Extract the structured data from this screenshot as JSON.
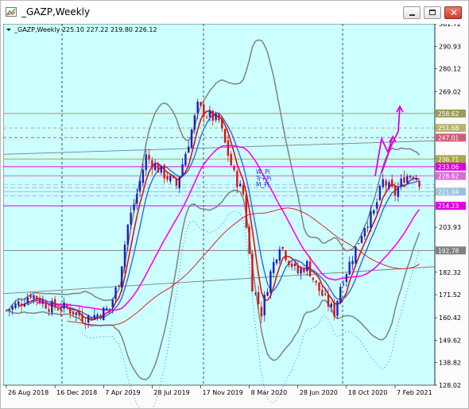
{
  "window": {
    "title": "_GAZP,Weekly",
    "buttons": [
      "minimize",
      "maximize",
      "close"
    ]
  },
  "chart_data": {
    "type": "candlestick",
    "info_line": "_GAZP,Weekly  225.10 227.22 219.80 226.12",
    "symbol_label": "_GAZP,Weekly",
    "ohlc": {
      "open": 225.1,
      "high": 227.22,
      "low": 219.8,
      "close": 226.12
    },
    "ylim": [
      128.02,
      301.72
    ],
    "y_ticks": [
      "301.72",
      "290.93",
      "280.12",
      "269.02",
      "258.62",
      "251.68",
      "247.01",
      "236.71",
      "233.06",
      "228.62",
      "221.04",
      "214.23",
      "203.93",
      "192.78",
      "182.32",
      "171.52",
      "160.42",
      "149.62",
      "138.82",
      "128.02"
    ],
    "x_ticks": [
      "26 Aug 2018",
      "16 Dec 2018",
      "7 Apr 2019",
      "28 Jul 2019",
      "17 Nov 2019",
      "8 Mar 2020",
      "28 Jun 2020",
      "18 Oct 2020",
      "7 Feb 2021"
    ],
    "price_levels": [
      {
        "value": 258.62,
        "color": "#9d9d55"
      },
      {
        "value": 251.68,
        "color": "#b5b56e"
      },
      {
        "value": 247.01,
        "color": "#d45a7c"
      },
      {
        "value": 236.71,
        "color": "#a6a64e"
      },
      {
        "value": 233.06,
        "color": "#e000e0"
      },
      {
        "value": 228.62,
        "color": "#d86bd8"
      },
      {
        "value": 221.04,
        "color": "#9cc0dc"
      },
      {
        "value": 214.23,
        "color": "#e000e0"
      },
      {
        "value": 192.78,
        "color": "#808080"
      }
    ],
    "pivot_labels": [
      "W_Pi",
      "Tr+Pi",
      "M_Pi"
    ],
    "colors": {
      "background": "#ccffff",
      "bull_candle": "#1f1fbf",
      "bear_candle": "#e01010",
      "bollinger": "#808080",
      "ma_slow": "#ff00ff",
      "ma_fast": "#e01010",
      "ma_blue": "#2a6bdc",
      "arrow": "#e000e0"
    }
  }
}
